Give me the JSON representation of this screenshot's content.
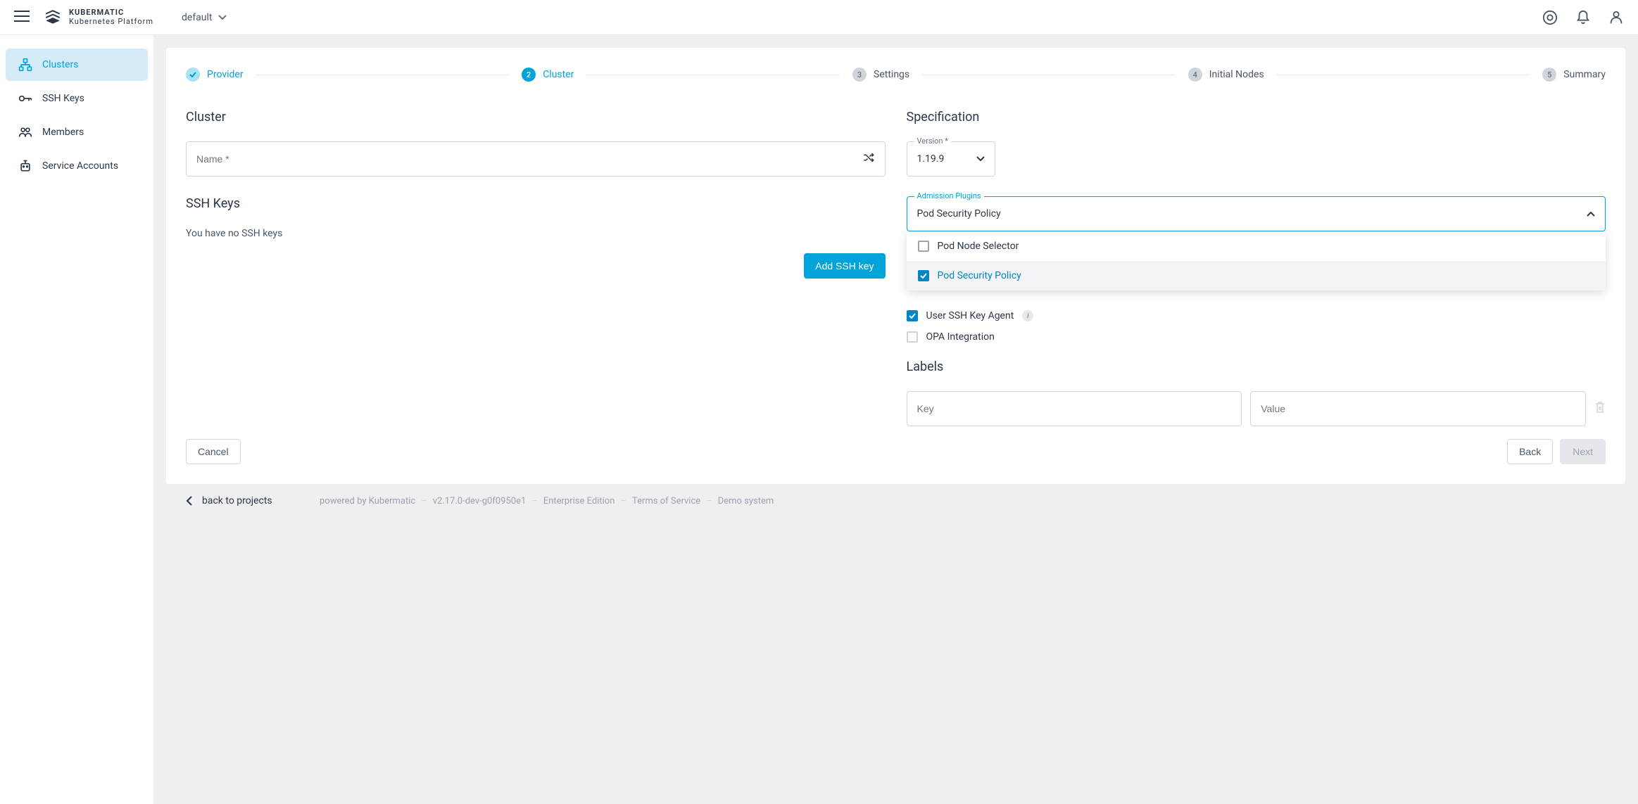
{
  "header": {
    "brand_top": "KUBERMATIC",
    "brand_bottom": "Kubernetes Platform",
    "project": "default"
  },
  "sidebar": {
    "items": [
      {
        "label": "Clusters"
      },
      {
        "label": "SSH Keys"
      },
      {
        "label": "Members"
      },
      {
        "label": "Service Accounts"
      }
    ]
  },
  "stepper": {
    "steps": [
      {
        "num": "✓",
        "label": "Provider"
      },
      {
        "num": "2",
        "label": "Cluster"
      },
      {
        "num": "3",
        "label": "Settings"
      },
      {
        "num": "4",
        "label": "Initial Nodes"
      },
      {
        "num": "5",
        "label": "Summary"
      }
    ]
  },
  "cluster": {
    "title": "Cluster",
    "name_placeholder": "Name *",
    "ssh_title": "SSH Keys",
    "ssh_empty": "You have no SSH keys",
    "add_ssh_btn": "Add SSH key"
  },
  "spec": {
    "title": "Specification",
    "version_label": "Version *",
    "version_value": "1.19.9",
    "admission_label": "Admission Plugins",
    "admission_value": "Pod Security Policy",
    "admission_options": [
      {
        "label": "Pod Node Selector",
        "checked": false
      },
      {
        "label": "Pod Security Policy",
        "checked": true
      }
    ],
    "check_ssh_agent": "User SSH Key Agent",
    "check_opa": "OPA Integration",
    "labels_title": "Labels",
    "key_placeholder": "Key",
    "value_placeholder": "Value"
  },
  "buttons": {
    "cancel": "Cancel",
    "back": "Back",
    "next": "Next"
  },
  "footer": {
    "back_projects": "back to projects",
    "powered": "powered by Kubermatic",
    "version": "v2.17.0-dev-g0f0950e1",
    "edition": "Enterprise Edition",
    "tos": "Terms of Service",
    "demo": "Demo system"
  }
}
